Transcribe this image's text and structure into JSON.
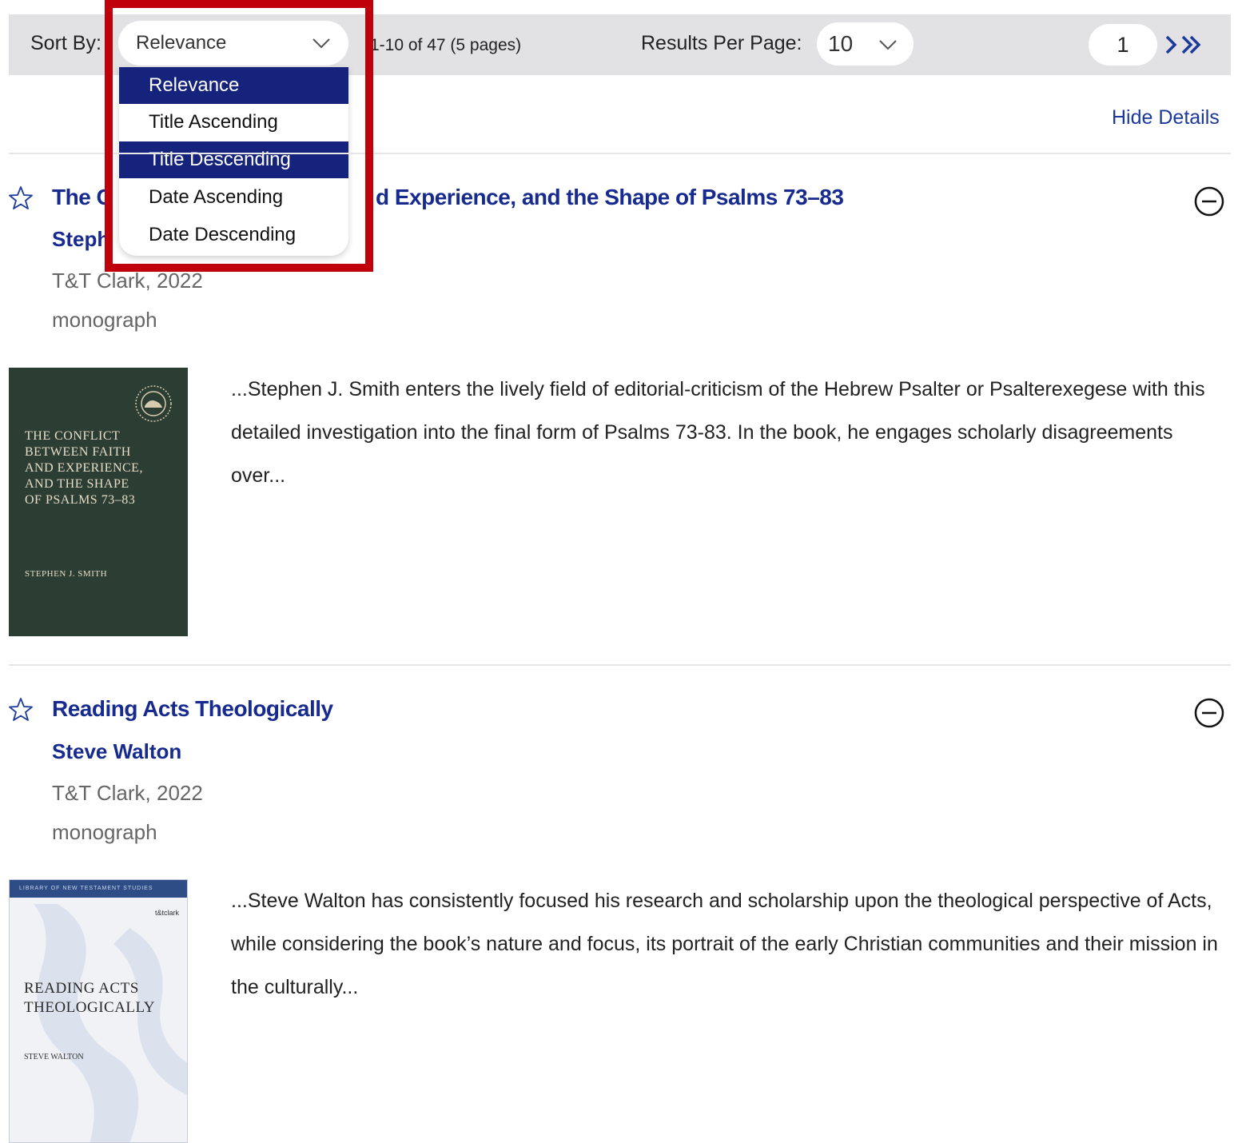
{
  "toolbar": {
    "sort_label": "Sort By:",
    "sort_value": "Relevance",
    "result_count": "1-10 of 47 (5 pages)",
    "rpp_label": "Results Per Page:",
    "rpp_value": "10",
    "page_value": "1"
  },
  "sort_options": [
    {
      "label": "Relevance",
      "selected": true
    },
    {
      "label": "Title Ascending",
      "selected": false
    },
    {
      "label": "Title Descending",
      "selected": true
    },
    {
      "label": "Date Ascending",
      "selected": false
    },
    {
      "label": "Date Descending",
      "selected": false
    }
  ],
  "hide_details": "Hide Details",
  "results": [
    {
      "title": "The Conflict between Faith and Experience, and the Shape of Psalms 73–83",
      "title_visible_left": "The C",
      "title_visible_right": "d Experience, and the Shape of Psalms 73–83",
      "author": "Stephen J. Smith",
      "author_visible": "Steph",
      "publisher": "T&T Clark, 2022",
      "type": "monograph",
      "snippet": "...Stephen J. Smith enters the lively field of editorial-criticism of the Hebrew Psalter or Psalterexegese with this detailed investigation into the final form of Psalms 73-83. In the book, he engages scholarly disagreements over...",
      "cover": {
        "title_lines": [
          "THE CONFLICT",
          "BETWEEN FAITH",
          "AND EXPERIENCE,",
          "AND THE SHAPE",
          "OF PSALMS 73–83"
        ],
        "author": "STEPHEN J. SMITH"
      }
    },
    {
      "title": "Reading Acts Theologically",
      "author": "Steve Walton",
      "publisher": "T&T Clark, 2022",
      "type": "monograph",
      "snippet": "...Steve Walton has consistently focused his research and scholarship upon the theological perspective of Acts, while considering the book’s nature and focus, its portrait of the early Christian communities and their mission in the culturally...",
      "cover": {
        "series": "LIBRARY OF NEW TESTAMENT STUDIES",
        "publisher_mark": "t&tclark",
        "title_lines": [
          "READING ACTS",
          "THEOLOGICALLY"
        ],
        "author": "STEVE WALTON"
      }
    }
  ],
  "colors": {
    "link": "#162a8f",
    "selected_option": "#16237d",
    "highlight_box": "#c0000a",
    "toolbar_bg": "#e2e2e4"
  },
  "icons": [
    "star-outline-icon",
    "collapse-minus-icon",
    "chevron-down-icon",
    "next-page-icon",
    "last-page-icon"
  ]
}
